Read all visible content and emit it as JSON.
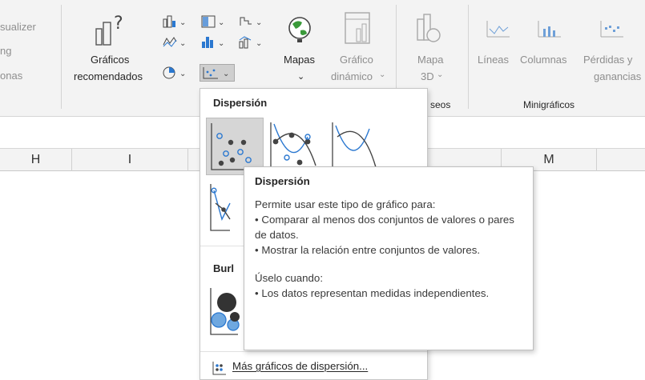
{
  "ribbon": {
    "left_partial": [
      "sualizer",
      "ng",
      "onas"
    ],
    "recommended_line1": "Gráficos",
    "recommended_line2": "recomendados",
    "maps_label": "Mapas",
    "pivot_line1": "Gráfico",
    "pivot_line2": "dinámico",
    "map3d_line1": "Mapa",
    "map3d_line2": "3D",
    "tours_partial": "seos",
    "sparkline_lines": "Líneas",
    "sparkline_columns": "Columnas",
    "sparkline_winloss_line1": "Pérdidas y",
    "sparkline_winloss_line2": "ganancias",
    "sparklines_group": "Minigráficos"
  },
  "columns": [
    "H",
    "I",
    "M"
  ],
  "menu": {
    "section1_title": "Dispersión",
    "section2_title_partial": "Burl",
    "more_label": "Más gráficos de dispersión...",
    "more_underline": "M"
  },
  "tooltip": {
    "title": "Dispersión",
    "p1": "Permite usar este tipo de gráfico para:",
    "p2": "• Comparar al menos dos conjuntos de valores o pares de datos.",
    "p3": "• Mostrar la relación entre conjuntos de valores.",
    "p4": "Úselo cuando:",
    "p5": "• Los datos representan medidas independientes."
  },
  "colors": {
    "accent_blue": "#2b78d0",
    "icon_dark": "#404040",
    "disabled": "#a8a8a8"
  }
}
